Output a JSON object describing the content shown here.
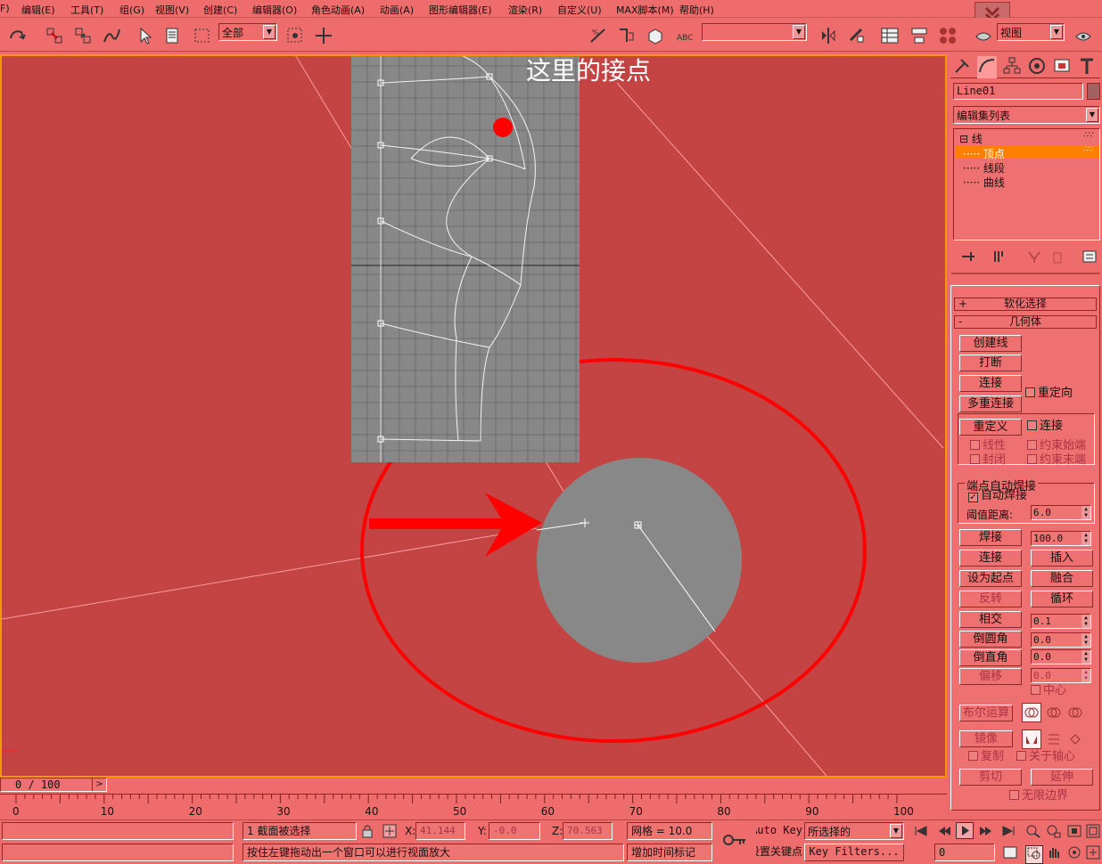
{
  "menu": {
    "items": [
      "F)",
      "编辑(E)",
      "工具(T)",
      "组(G)",
      "视图(V)",
      "创建(C)",
      "编辑器(O)",
      "角色动画(A)",
      "动画(A)",
      "图形编辑器(E)",
      "渲染(R)",
      "自定义(U)",
      "MAX脚本(M)",
      "帮助(H)"
    ]
  },
  "toolbar": {
    "filter_value": "全部",
    "named_sel_value": "",
    "ref_coord_value": "视图"
  },
  "overlay": {
    "annotation_text": "这里的接点"
  },
  "panel": {
    "object_name": "Line01",
    "modifier_list": "编辑集列表",
    "stack": [
      {
        "label": "线",
        "prefix": "⊟"
      },
      {
        "label": "顶点",
        "selected": true
      },
      {
        "label": "线段"
      },
      {
        "label": "曲线"
      }
    ],
    "rollout_soft": "软化选择",
    "rollout_soft_sign": "+",
    "rollout_geom": "几何体",
    "rollout_geom_sign": "-",
    "btn_create_line": "创建线",
    "btn_break": "打断",
    "btn_attach": "连接",
    "chk_reorient": "重定向",
    "btn_attach_mult": "多重连接",
    "btn_refine": "重定义",
    "chk_connect": "连接",
    "chk_linear": "线性",
    "chk_bind_first": "约束始端",
    "chk_closed": "封闭",
    "chk_bind_last": "约束末端",
    "end_weld_group": "端点自动焊接",
    "chk_auto_weld": "自动焊接",
    "threshold_label": "阈值距离:",
    "threshold_value": "6.0",
    "btn_weld": "焊接",
    "weld_value": "100.0",
    "btn_connect": "连接",
    "btn_insert": "插入",
    "btn_make_first": "设为起点",
    "btn_fuse": "融合",
    "btn_reverse": "反转",
    "btn_cycle": "循环",
    "btn_crossinsert": "相交",
    "crossinsert_value": "0.1",
    "btn_fillet": "倒圆角",
    "fillet_value": "0.0",
    "btn_chamfer": "倒直角",
    "chamfer_value": "0.0",
    "btn_outline": "偏移",
    "outline_value": "0.0",
    "chk_center": "中心",
    "btn_boolean": "布尔运算",
    "btn_mirror": "镜像",
    "chk_copy": "复制",
    "chk_about_pivot": "关于轴心",
    "btn_trim": "剪切",
    "btn_extend": "延伸",
    "chk_infinite": "无限边界"
  },
  "timeline": {
    "frame_display": "0 / 100",
    "ticks": [
      "0",
      "10",
      "20",
      "30",
      "40",
      "50",
      "60",
      "70",
      "80",
      "90",
      "100"
    ]
  },
  "status": {
    "selection": "1 截面被选择",
    "x_label": "X:",
    "x_value": "41.144",
    "y_label": "Y:",
    "y_value": "-0.0",
    "z_label": "Z:",
    "z_value": "70.563",
    "grid": "网格 = 10.0",
    "prompt": "按住左键拖动出一个窗口可以进行视面放大",
    "add_time_tag": "增加时间标记",
    "auto_key": "Auto Key",
    "set_key": "设置关键点",
    "key_mode": "所选择的",
    "key_filters": "Key Filters...",
    "frame_value": "0"
  },
  "colors": {
    "ui_bg": "#ee6c6c",
    "viewport_bg": "#c44444",
    "viewport_border": "#f39a00",
    "highlight": "#ff8000",
    "annotation_red": "#ff0000",
    "reference_gray": "#888888"
  }
}
